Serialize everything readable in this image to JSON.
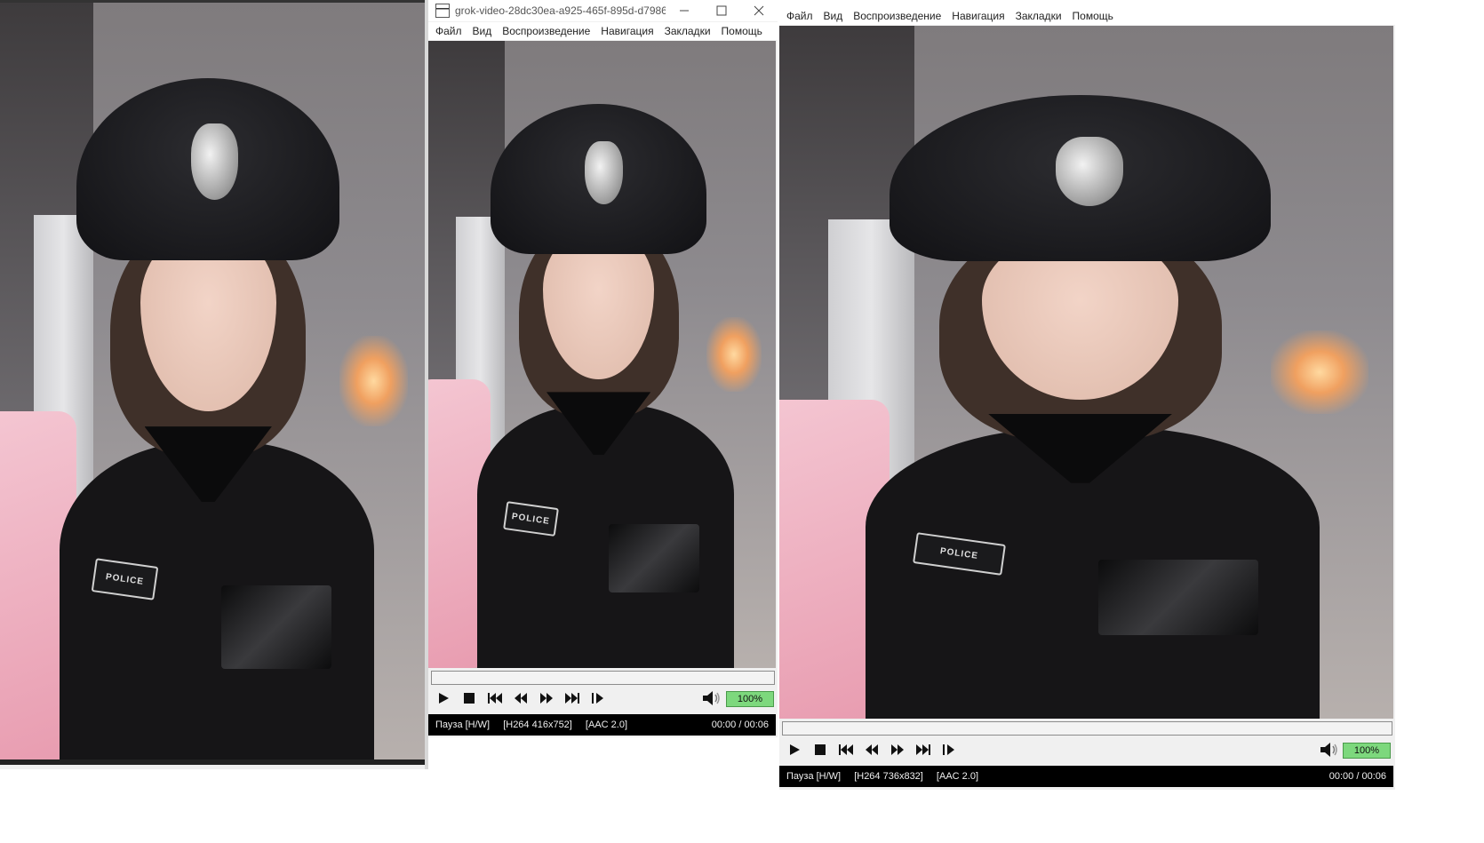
{
  "left_window": {},
  "middle_window": {
    "title": "grok-video-28dc30ea-a925-465f-895d-d7986f...",
    "menu": [
      "Файл",
      "Вид",
      "Воспроизведение",
      "Навигация",
      "Закладки",
      "Помощь"
    ],
    "status": {
      "state": "Пауза [H/W]",
      "video": "[H264 416x752]",
      "audio": "[AAC 2.0]",
      "time": "00:00 / 00:06"
    },
    "volume": "100%"
  },
  "right_window": {
    "menu": [
      "Файл",
      "Вид",
      "Воспроизведение",
      "Навигация",
      "Закладки",
      "Помощь"
    ],
    "status": {
      "state": "Пауза [H/W]",
      "video": "[H264 736x832]",
      "audio": "[AAC 2.0]",
      "time": "00:00 / 00:06"
    },
    "volume": "100%"
  },
  "video": {
    "patch_text": "POLICE"
  },
  "colors": {
    "volume_fill": "#7dd87d",
    "status_bg": "#000000"
  },
  "icons": [
    "play-icon",
    "stop-icon",
    "prev-icon",
    "rewind-icon",
    "forward-icon",
    "next-icon",
    "frame-step-icon",
    "volume-icon"
  ]
}
